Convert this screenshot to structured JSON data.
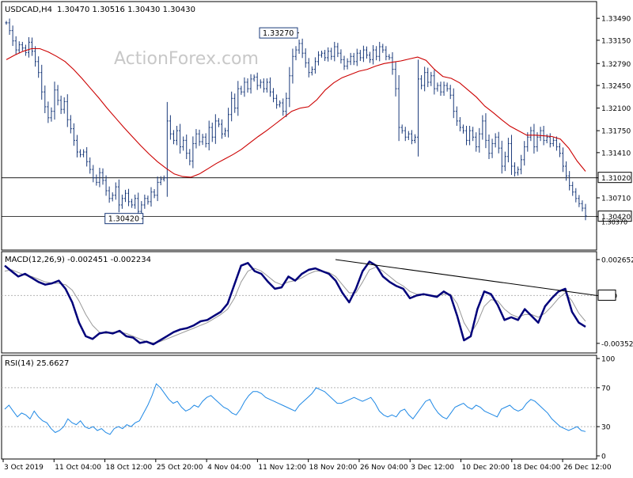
{
  "chart_data": [
    {
      "type": "candlestick",
      "panel": "price",
      "symbol_label": "USDCAD,H4",
      "ohlc_text": "1.30470 1.30516 1.30430 1.30430",
      "watermark": "ActionForex.com",
      "ylim": [
        1.2995,
        1.337
      ],
      "y_ticks": [
        "1.33490",
        "1.33150",
        "1.32790",
        "1.32450",
        "1.32100",
        "1.31750",
        "1.31410",
        "1.31020",
        "1.30710",
        "1.30420"
      ],
      "y_tick_values": [
        1.3349,
        1.3315,
        1.3279,
        1.3245,
        1.321,
        1.3175,
        1.3141,
        1.3102,
        1.3071,
        1.3042
      ],
      "hidden_tick": "1.30370",
      "horizontal_levels": [
        1.3102,
        1.3042
      ],
      "price_labels": [
        {
          "text": "1.31020",
          "value": 1.3102,
          "highlight": true
        },
        {
          "text": "1.30420",
          "value": 1.3042,
          "highlight": true
        }
      ],
      "annotations": [
        {
          "text": "1.33270",
          "bar_index": 90,
          "value": 1.3327
        },
        {
          "text": "1.30420",
          "bar_index": 41,
          "value": 1.3042
        }
      ],
      "close_series": [
        1.3342,
        1.333,
        1.3314,
        1.33,
        1.3308,
        1.3303,
        1.3296,
        1.3312,
        1.3298,
        1.3282,
        1.3265,
        1.3235,
        1.3212,
        1.3195,
        1.3205,
        1.3238,
        1.3222,
        1.3208,
        1.322,
        1.3192,
        1.3178,
        1.316,
        1.3142,
        1.3138,
        1.3142,
        1.3127,
        1.3115,
        1.3102,
        1.3095,
        1.311,
        1.3098,
        1.3082,
        1.307,
        1.3075,
        1.3088,
        1.306,
        1.307,
        1.3078,
        1.3065,
        1.306,
        1.307,
        1.305,
        1.306,
        1.307,
        1.3065,
        1.308,
        1.3075,
        1.3095,
        1.31,
        1.3102,
        1.319,
        1.317,
        1.316,
        1.3175,
        1.315,
        1.316,
        1.314,
        1.3128,
        1.3155,
        1.317,
        1.3158,
        1.3165,
        1.3155,
        1.318,
        1.3165,
        1.319,
        1.3185,
        1.317,
        1.3175,
        1.32,
        1.3225,
        1.321,
        1.324,
        1.3235,
        1.325,
        1.324,
        1.3255,
        1.3258,
        1.3245,
        1.325,
        1.324,
        1.325,
        1.3235,
        1.3225,
        1.3215,
        1.3218,
        1.3205,
        1.3225,
        1.326,
        1.329,
        1.33,
        1.331,
        1.3295,
        1.328,
        1.3265,
        1.327,
        1.3282,
        1.3292,
        1.3295,
        1.3288,
        1.3298,
        1.329,
        1.3305,
        1.3295,
        1.3285,
        1.3275,
        1.3282,
        1.329,
        1.3282,
        1.3295,
        1.3288,
        1.33,
        1.3292,
        1.3285,
        1.33,
        1.329,
        1.3305,
        1.33,
        1.329,
        1.3288,
        1.327,
        1.324,
        1.318,
        1.3175,
        1.3165,
        1.317,
        1.316,
        1.3165,
        1.3255,
        1.3245,
        1.3265,
        1.325,
        1.326,
        1.324,
        1.3245,
        1.3235,
        1.3245,
        1.324,
        1.323,
        1.3205,
        1.319,
        1.318,
        1.3175,
        1.316,
        1.3175,
        1.3165,
        1.315,
        1.317,
        1.319,
        1.316,
        1.314,
        1.3155,
        1.3165,
        1.3148,
        1.312,
        1.3135,
        1.3155,
        1.312,
        1.311,
        1.3115,
        1.313,
        1.315,
        1.3165,
        1.3175,
        1.315,
        1.3165,
        1.3175,
        1.316,
        1.3165,
        1.3155,
        1.316,
        1.315,
        1.314,
        1.312,
        1.3105,
        1.309,
        1.308,
        1.307,
        1.3062,
        1.3055,
        1.3043
      ],
      "ma_series": [
        1.3285,
        1.3292,
        1.3298,
        1.3302,
        1.3302,
        1.3297,
        1.329,
        1.3282,
        1.327,
        1.3256,
        1.3241,
        1.3226,
        1.321,
        1.3195,
        1.318,
        1.3166,
        1.3152,
        1.3139,
        1.3127,
        1.3117,
        1.3108,
        1.3104,
        1.3103,
        1.3108,
        1.3116,
        1.3124,
        1.3131,
        1.3138,
        1.3146,
        1.3156,
        1.3166,
        1.3175,
        1.3185,
        1.3195,
        1.3205,
        1.321,
        1.3212,
        1.3223,
        1.3238,
        1.3249,
        1.3257,
        1.3262,
        1.3267,
        1.327,
        1.3275,
        1.3279,
        1.3281,
        1.3283,
        1.3286,
        1.3289,
        1.3284,
        1.327,
        1.3259,
        1.3256,
        1.3249,
        1.3238,
        1.3227,
        1.3213,
        1.3203,
        1.3192,
        1.3182,
        1.3175,
        1.3168,
        1.3168,
        1.3167,
        1.3166,
        1.3162,
        1.3148,
        1.3128,
        1.3112
      ],
      "ma_x_ticks": [
        0,
        10,
        20,
        30,
        40,
        50,
        60,
        70,
        80,
        90,
        100,
        110,
        120,
        130,
        140,
        150,
        160,
        170,
        180
      ],
      "ma_x_ticks_note": "",
      "line_color": "#1a3a7a",
      "ma_color": "#cc0000"
    },
    {
      "type": "line",
      "panel": "macd",
      "label": "MACD(12,26,9) -0.002451 -0.002234",
      "ylim": [
        -0.004,
        0.003
      ],
      "y_ticks": [
        "0.002652",
        "0.00",
        "-0.003526"
      ],
      "y_tick_values": [
        0.002652,
        0.0,
        -0.003526
      ],
      "zero_label": "0.00",
      "series": [
        {
          "name": "",
          "color": "#00007a",
          "width": 2.5,
          "values": [
            0.0022,
            0.0018,
            0.0014,
            0.0016,
            0.0013,
            0.001,
            0.0008,
            0.0009,
            0.0011,
            0.0005,
            -0.0005,
            -0.002,
            -0.003,
            -0.0032,
            -0.0028,
            -0.0027,
            -0.0028,
            -0.0026,
            -0.003,
            -0.0031,
            -0.0035,
            -0.0034,
            -0.0036,
            -0.0033,
            -0.003,
            -0.0027,
            -0.0025,
            -0.0024,
            -0.0022,
            -0.0019,
            -0.0018,
            -0.0015,
            -0.0012,
            -0.0006,
            0.0008,
            0.0022,
            0.0024,
            0.0018,
            0.0016,
            0.001,
            0.0005,
            0.0006,
            0.0014,
            0.0011,
            0.0016,
            0.0019,
            0.002,
            0.0018,
            0.0016,
            0.0011,
            0.0002,
            -0.0005,
            0.0005,
            0.0018,
            0.0025,
            0.0022,
            0.0014,
            0.001,
            0.0007,
            0.0005,
            -0.0002,
            0.0,
            0.0001,
            0.0,
            -0.0001,
            0.0003,
            0.0,
            -0.0015,
            -0.0033,
            -0.003,
            -0.001,
            0.0003,
            0.0001,
            -0.0007,
            -0.0018,
            -0.0016,
            -0.0018,
            -0.001,
            -0.0015,
            -0.002,
            -0.0008,
            -0.0002,
            0.0003,
            0.0005,
            -0.0012,
            -0.002,
            -0.0023
          ]
        },
        {
          "name": "",
          "color": "#999999",
          "width": 1,
          "values": [
            0.0018,
            0.0019,
            0.0017,
            0.0015,
            0.0014,
            0.0012,
            0.001,
            0.0009,
            0.0009,
            0.0008,
            0.0004,
            -0.0004,
            -0.0014,
            -0.0022,
            -0.0027,
            -0.0028,
            -0.0027,
            -0.0027,
            -0.0028,
            -0.003,
            -0.0032,
            -0.0034,
            -0.0035,
            -0.0034,
            -0.0032,
            -0.003,
            -0.0028,
            -0.0026,
            -0.0024,
            -0.0022,
            -0.002,
            -0.0017,
            -0.0014,
            -0.001,
            -0.0002,
            0.001,
            0.0018,
            0.002,
            0.0018,
            0.0014,
            0.001,
            0.0008,
            0.001,
            0.0011,
            0.0013,
            0.0016,
            0.0018,
            0.0018,
            0.0017,
            0.0014,
            0.0008,
            0.0002,
            0.0002,
            0.001,
            0.0019,
            0.0021,
            0.0018,
            0.0014,
            0.001,
            0.0007,
            0.0003,
            0.0001,
            0.0001,
            0.0,
            0.0,
            0.0001,
            0.0001,
            -0.0006,
            -0.002,
            -0.0028,
            -0.002,
            -0.0008,
            -0.0003,
            -0.0004,
            -0.001,
            -0.0014,
            -0.0016,
            -0.0014,
            -0.0014,
            -0.0016,
            -0.0013,
            -0.0008,
            -0.0002,
            0.0002,
            -0.0004,
            -0.0013,
            -0.0019
          ]
        }
      ],
      "trendline": {
        "from": [
          0.56,
          0.00265
        ],
        "to": [
          1.0,
          0.0
        ]
      }
    },
    {
      "type": "line",
      "panel": "rsi",
      "label": "RSI(14) 25.6627",
      "ylim": [
        0,
        100
      ],
      "y_ticks": [
        "100",
        "70",
        "30",
        "0"
      ],
      "y_tick_values": [
        100,
        70,
        30,
        0
      ],
      "levels": [
        70,
        30
      ],
      "series": [
        {
          "name": "",
          "color": "#1e88e5",
          "width": 1,
          "values": [
            48,
            52,
            46,
            40,
            44,
            42,
            38,
            46,
            40,
            36,
            34,
            28,
            24,
            26,
            30,
            38,
            34,
            32,
            36,
            30,
            28,
            30,
            26,
            28,
            24,
            22,
            28,
            30,
            28,
            32,
            30,
            34,
            36,
            44,
            52,
            62,
            74,
            70,
            64,
            58,
            54,
            56,
            50,
            46,
            48,
            52,
            50,
            56,
            60,
            62,
            58,
            54,
            50,
            48,
            44,
            42,
            48,
            56,
            62,
            66,
            66,
            64,
            60,
            58,
            56,
            54,
            52,
            50,
            48,
            46,
            52,
            56,
            60,
            64,
            70,
            68,
            66,
            62,
            58,
            54,
            54,
            56,
            58,
            60,
            58,
            56,
            58,
            60,
            54,
            46,
            42,
            40,
            42,
            40,
            46,
            48,
            42,
            38,
            44,
            50,
            56,
            58,
            50,
            44,
            40,
            38,
            44,
            50,
            52,
            54,
            50,
            48,
            52,
            50,
            46,
            44,
            42,
            40,
            48,
            50,
            52,
            48,
            46,
            48,
            54,
            58,
            56,
            52,
            48,
            44,
            38,
            34,
            30,
            28,
            26,
            28,
            30,
            26,
            25
          ]
        }
      ]
    }
  ],
  "x_axis": {
    "labels": [
      "3 Oct 2019",
      "11 Oct 04:00",
      "18 Oct 12:00",
      "25 Oct 20:00",
      "4 Nov 04:00",
      "11 Nov 12:00",
      "18 Nov 20:00",
      "26 Nov 04:00",
      "3 Dec 12:00",
      "10 Dec 20:00",
      "18 Dec 04:00",
      "26 Dec 12:00"
    ]
  },
  "colors": {
    "axis": "#000000",
    "grid_dotted": "#b5b5b5",
    "price_line": "#1a3a7a",
    "ma": "#cc0000",
    "macd": "#00007a",
    "signal": "#999999",
    "rsi": "#1e88e5",
    "watermark": "#c8c8c8"
  }
}
